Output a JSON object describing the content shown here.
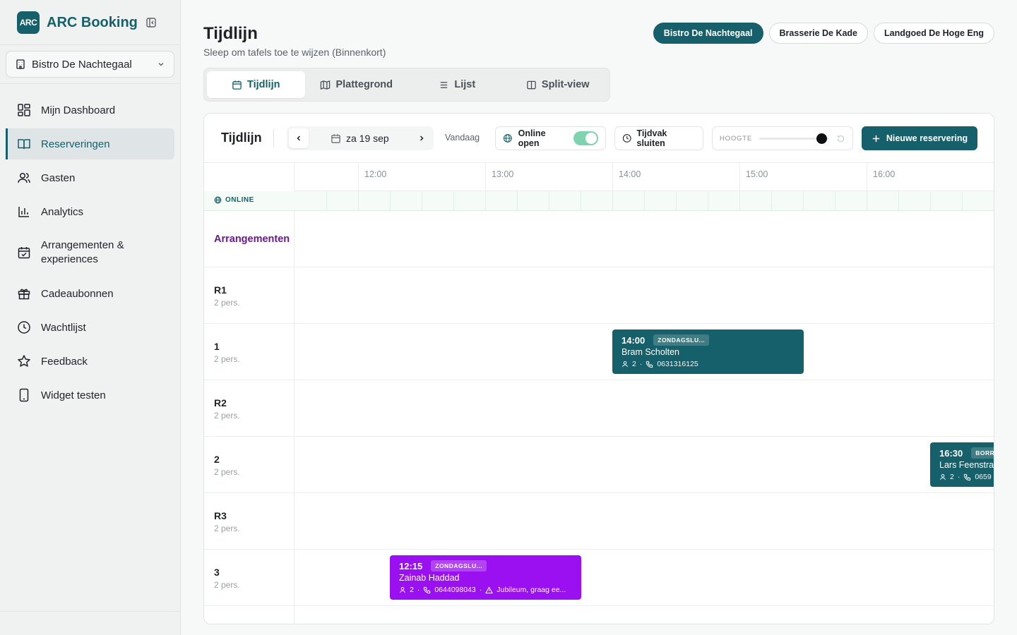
{
  "brand": {
    "logo_text": "ARC",
    "name": "ARC Booking"
  },
  "sidebar": {
    "venue_selected": "Bistro De Nachtegaal",
    "items": [
      {
        "label": "Mijn Dashboard",
        "icon": "dashboard-icon",
        "active": false
      },
      {
        "label": "Reserveringen",
        "icon": "book-icon",
        "active": true
      },
      {
        "label": "Gasten",
        "icon": "users-icon",
        "active": false
      },
      {
        "label": "Analytics",
        "icon": "bar-chart-icon",
        "active": false
      },
      {
        "label": "Arrangementen & experiences",
        "icon": "calendar-check-icon",
        "active": false
      },
      {
        "label": "Cadeaubonnen",
        "icon": "gift-icon",
        "active": false
      },
      {
        "label": "Wachtlijst",
        "icon": "clock-icon",
        "active": false
      },
      {
        "label": "Feedback",
        "icon": "star-icon",
        "active": false
      },
      {
        "label": "Widget testen",
        "icon": "phone-icon",
        "active": false
      }
    ]
  },
  "header": {
    "title": "Tijdlijn",
    "subtitle": "Sleep om tafels toe te wijzen (Binnenkort)",
    "venues": [
      "Bistro De Nachtegaal",
      "Brasserie De Kade",
      "Landgoed De Hoge Eng"
    ],
    "active_venue": "Bistro De Nachtegaal"
  },
  "view_tabs": [
    "Tijdlijn",
    "Plattegrond",
    "Lijst",
    "Split-view"
  ],
  "active_tab": "Tijdlijn",
  "toolbar": {
    "title": "Tijdlijn",
    "date": "za 19 sep",
    "today": "Vandaag",
    "online_label": "Online open",
    "online_on": true,
    "close_slot": "Tijdvak sluiten",
    "height_label": "HOOGTE",
    "height_level": 0.9,
    "new_reservation": "Nieuwe reservering"
  },
  "timeline": {
    "times": [
      "12:00",
      "13:00",
      "14:00",
      "15:00",
      "16:00"
    ],
    "online_row_label": "ONLINE",
    "arrangements_label": "Arrangementen",
    "tables": [
      {
        "name": "R1",
        "capacity": "2 pers."
      },
      {
        "name": "1",
        "capacity": "2 pers."
      },
      {
        "name": "R2",
        "capacity": "2 pers."
      },
      {
        "name": "2",
        "capacity": "2 pers."
      },
      {
        "name": "R3",
        "capacity": "2 pers."
      },
      {
        "name": "3",
        "capacity": "2 pers."
      }
    ],
    "bookings": [
      {
        "table": "1",
        "time": "14:00",
        "tag": "ZONDAGSLU...",
        "name": "Bram Scholten",
        "guests": "2",
        "phone": "0631316125",
        "note": "",
        "color": "#15606a"
      },
      {
        "table": "2",
        "time": "16:30",
        "tag": "BORRE",
        "name": "Lars Feenstra",
        "guests": "2",
        "phone": "0659",
        "note": "",
        "color": "#15606a"
      },
      {
        "table": "3",
        "time": "12:15",
        "tag": "ZONDAGSLU...",
        "name": "Zainab Haddad",
        "guests": "2",
        "phone": "0644098043",
        "note": "Jubileum, graag ee...",
        "color": "#9b10f0"
      }
    ]
  },
  "colors": {
    "brand": "#15606a",
    "purple_booking": "#9b10f0",
    "arrangements_text": "#6a1b8a"
  }
}
